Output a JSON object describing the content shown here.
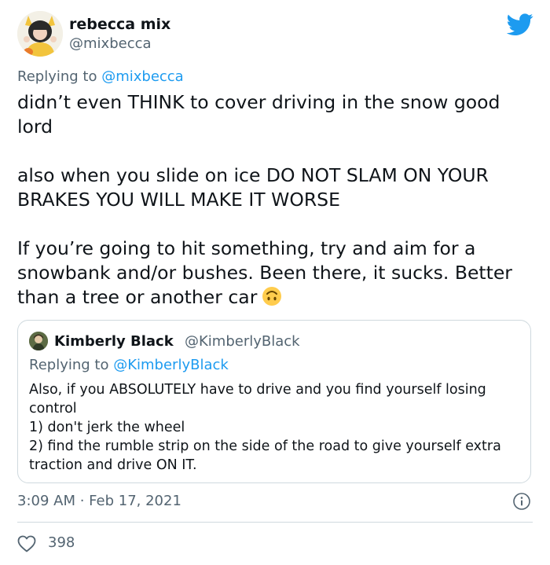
{
  "author": {
    "display_name": "rebecca mix",
    "handle": "@mixbecca"
  },
  "replying": {
    "prefix": "Replying to ",
    "mention": "@mixbecca"
  },
  "tweet": {
    "paragraphs": [
      "didn’t even THINK to cover driving in the snow good lord",
      "also when you slide on ice DO NOT SLAM ON YOUR BRAKES YOU WILL MAKE IT WORSE",
      "If you’re going to hit something, try and aim for a snowbank and/or bushes. Been there, it sucks. Better than a tree or another car"
    ],
    "emoji": "upside-down-face-emoji"
  },
  "quote": {
    "display_name": "Kimberly Black",
    "handle": "@KimberlyBlack",
    "replying_prefix": "Replying to ",
    "replying_mention": "@KimberlyBlack",
    "lines": [
      "Also, if you ABSOLUTELY have to drive and you find yourself losing control",
      "1) don't jerk the wheel",
      "2) find the rumble strip on the side of the road to give yourself extra traction and drive ON IT."
    ]
  },
  "footer": {
    "timestamp": "3:09 AM · Feb 17, 2021",
    "likes": "398"
  },
  "icons": {
    "brand": "twitter-bird-icon",
    "info": "info-icon",
    "like": "heart-icon"
  },
  "colors": {
    "brand_blue": "#1d9bf0",
    "text": "#0f1419",
    "muted": "#536471",
    "border": "#cfd9de"
  }
}
